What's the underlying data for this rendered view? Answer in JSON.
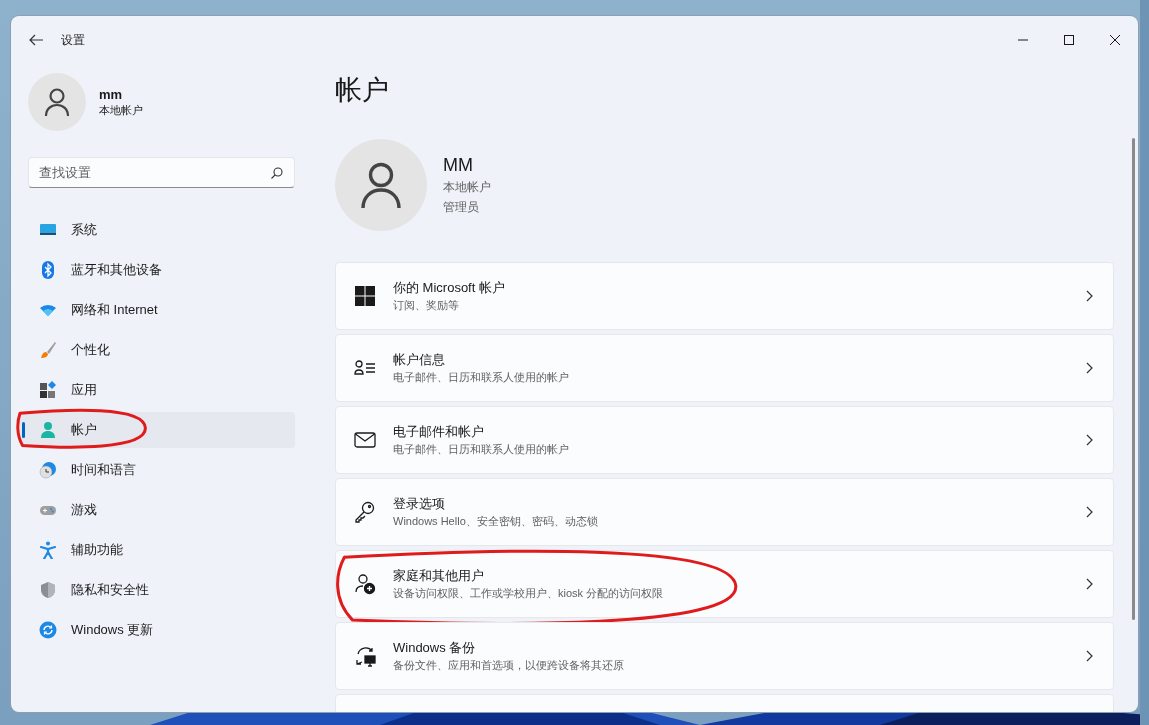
{
  "window": {
    "title": "设置"
  },
  "user": {
    "name": "mm",
    "type": "本地帐户"
  },
  "search": {
    "placeholder": "查找设置"
  },
  "nav": [
    {
      "label": "系统",
      "selected": false,
      "circled": false
    },
    {
      "label": "蓝牙和其他设备",
      "selected": false,
      "circled": false
    },
    {
      "label": "网络和 Internet",
      "selected": false,
      "circled": false
    },
    {
      "label": "个性化",
      "selected": false,
      "circled": false
    },
    {
      "label": "应用",
      "selected": false,
      "circled": false
    },
    {
      "label": "帐户",
      "selected": true,
      "circled": true
    },
    {
      "label": "时间和语言",
      "selected": false,
      "circled": false
    },
    {
      "label": "游戏",
      "selected": false,
      "circled": false
    },
    {
      "label": "辅助功能",
      "selected": false,
      "circled": false
    },
    {
      "label": "隐私和安全性",
      "selected": false,
      "circled": false
    },
    {
      "label": "Windows 更新",
      "selected": false,
      "circled": false
    }
  ],
  "page": {
    "title": "帐户",
    "profile": {
      "name": "MM",
      "lines": [
        "本地帐户",
        "管理员"
      ]
    }
  },
  "cards": [
    {
      "title": "你的 Microsoft 帐户",
      "subtitle": "订阅、奖励等",
      "circled": false
    },
    {
      "title": "帐户信息",
      "subtitle": "电子邮件、日历和联系人使用的帐户",
      "circled": false
    },
    {
      "title": "电子邮件和帐户",
      "subtitle": "电子邮件、日历和联系人使用的帐户",
      "circled": false
    },
    {
      "title": "登录选项",
      "subtitle": "Windows Hello、安全密钥、密码、动态锁",
      "circled": false
    },
    {
      "title": "家庭和其他用户",
      "subtitle": "设备访问权限、工作或学校用户、kiosk 分配的访问权限",
      "circled": true
    },
    {
      "title": "Windows 备份",
      "subtitle": "备份文件、应用和首选项，以便跨设备将其还原",
      "circled": false
    }
  ]
}
